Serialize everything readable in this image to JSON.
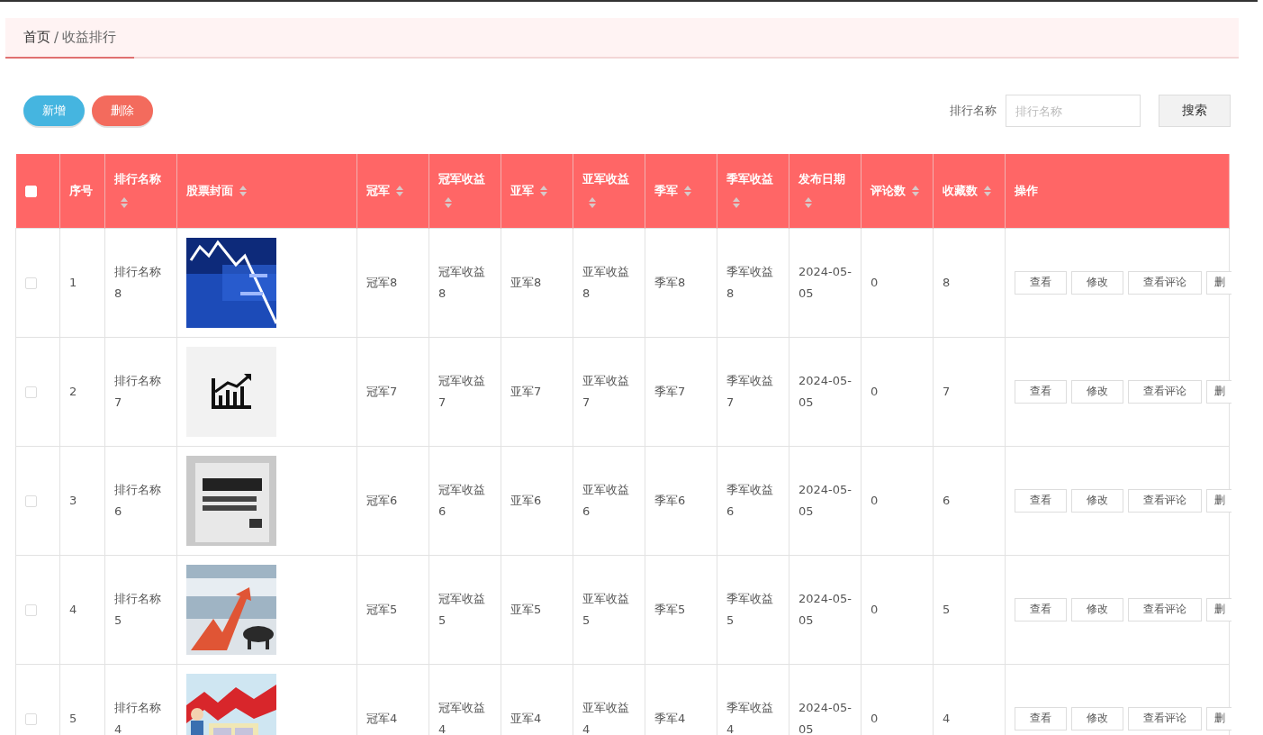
{
  "breadcrumb": {
    "home": "首页",
    "separator": "/",
    "current": "收益排行"
  },
  "actions": [
    {
      "label": "新增",
      "kind": "primary"
    },
    {
      "label": "删除",
      "kind": "danger"
    }
  ],
  "search": {
    "label": "排行名称",
    "placeholder": "排行名称",
    "button": "搜索"
  },
  "table": {
    "select_all": {
      "checked": false
    },
    "columns": [
      {
        "label": "序号",
        "sortable": false
      },
      {
        "label": "排行名称",
        "sortable": true
      },
      {
        "label": "股票封面",
        "sortable": true
      },
      {
        "label": "冠军",
        "sortable": true
      },
      {
        "label": "冠军收益",
        "sortable": true
      },
      {
        "label": "亚军",
        "sortable": true
      },
      {
        "label": "亚军收益",
        "sortable": true
      },
      {
        "label": "季军",
        "sortable": true
      },
      {
        "label": "季军收益",
        "sortable": true
      },
      {
        "label": "发布日期",
        "sortable": true
      },
      {
        "label": "评论数",
        "sortable": true
      },
      {
        "label": "收藏数",
        "sortable": true
      },
      {
        "label": "操作",
        "sortable": false
      }
    ],
    "rows": [
      {
        "checked": false,
        "cells": [
          "1",
          "排行名称8",
          {
            "kind": "picture"
          },
          "冠军8",
          "冠军收益8",
          "亚军8",
          "亚军收益8",
          "季军8",
          "季军收益8",
          "2024-05-05",
          "0",
          "8"
        ],
        "buttons": [
          "查看",
          "修改",
          "查看评论",
          "删"
        ]
      },
      {
        "checked": false,
        "cells": [
          "2",
          "排行名称7",
          {
            "kind": "picture"
          },
          "冠军7",
          "冠军收益7",
          "亚军7",
          "亚军收益7",
          "季军7",
          "季军收益7",
          "2024-05-05",
          "0",
          "7"
        ],
        "buttons": [
          "查看",
          "修改",
          "查看评论",
          "删"
        ]
      },
      {
        "checked": false,
        "cells": [
          "3",
          "排行名称6",
          {
            "kind": "picture"
          },
          "冠军6",
          "冠军收益6",
          "亚军6",
          "亚军收益6",
          "季军6",
          "季军收益6",
          "2024-05-05",
          "0",
          "6"
        ],
        "buttons": [
          "查看",
          "修改",
          "查看评论",
          "删"
        ]
      },
      {
        "checked": false,
        "cells": [
          "4",
          "排行名称5",
          {
            "kind": "picture"
          },
          "冠军5",
          "冠军收益5",
          "亚军5",
          "亚军收益5",
          "季军5",
          "季军收益5",
          "2024-05-05",
          "0",
          "5"
        ],
        "buttons": [
          "查看",
          "修改",
          "查看评论",
          "删"
        ]
      },
      {
        "checked": false,
        "cells": [
          "5",
          "排行名称4",
          {
            "kind": "picture"
          },
          "冠军4",
          "冠军收益4",
          "亚军4",
          "亚军收益4",
          "季军4",
          "季军收益4",
          "2024-05-05",
          "0",
          "4"
        ],
        "buttons": [
          "查看",
          "修改",
          "查看评论",
          "删"
        ]
      }
    ]
  }
}
